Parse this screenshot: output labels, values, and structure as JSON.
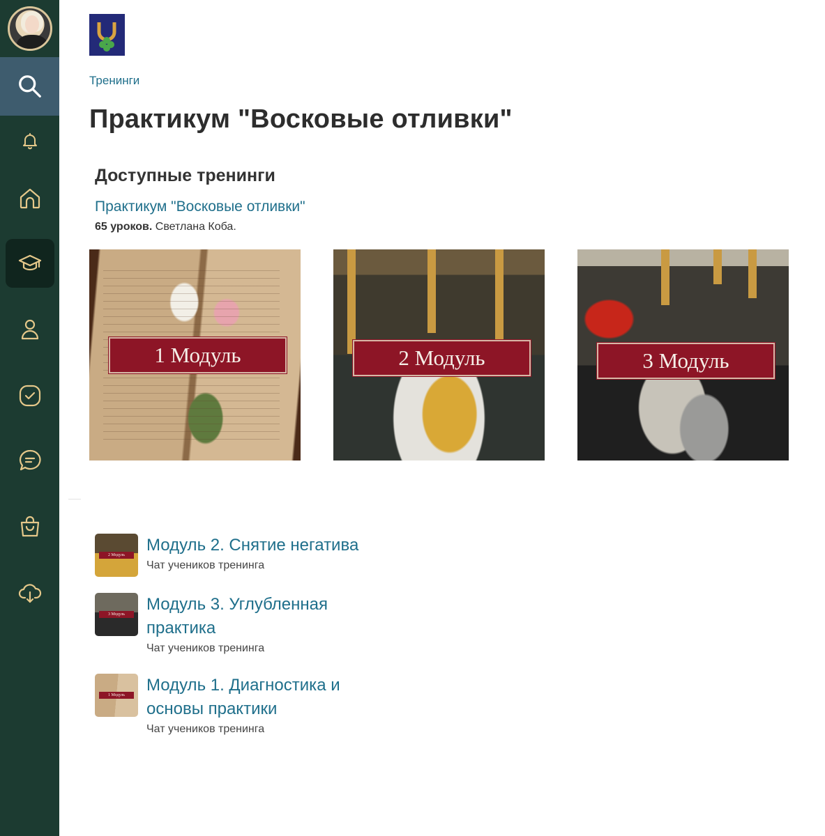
{
  "sidebar": {
    "items": [
      {
        "id": "search",
        "icon": "search-icon"
      },
      {
        "id": "notifications",
        "icon": "bell-icon"
      },
      {
        "id": "home",
        "icon": "home-icon"
      },
      {
        "id": "trainings",
        "icon": "graduation-cap-icon",
        "active": true
      },
      {
        "id": "profile",
        "icon": "user-icon"
      },
      {
        "id": "tasks",
        "icon": "checkbox-icon"
      },
      {
        "id": "chats",
        "icon": "chat-icon"
      },
      {
        "id": "shop",
        "icon": "shopping-bag-icon"
      },
      {
        "id": "downloads",
        "icon": "cloud-download-icon"
      }
    ],
    "colors": {
      "background": "#1c3b31",
      "active_background": "#10251e",
      "search_background": "#3e5c6e",
      "icon": "#e5c88a"
    }
  },
  "breadcrumb": "Тренинги",
  "page_title": "Практикум \"Восковые отливки\"",
  "available": {
    "heading": "Доступные тренинги",
    "training_title": "Практикум \"Восковые отливки\"",
    "lessons_count": "65 уроков.",
    "author": " Светлана Коба."
  },
  "modules": [
    {
      "banner": "1 Модуль"
    },
    {
      "banner": "2 Модуль"
    },
    {
      "banner": "3 Модуль"
    }
  ],
  "chats": [
    {
      "title": "Модуль 2. Снятие негатива",
      "subtitle": "Чат учеников тренинга",
      "thumb_banner": "2 Модуль"
    },
    {
      "title": "Модуль 3. Углубленная практика",
      "subtitle": "Чат учеников тренинга",
      "thumb_banner": "3 Модуль"
    },
    {
      "title": "Модуль 1. Диагностика и основы практики",
      "subtitle": "Чат учеников тренинга",
      "thumb_banner": "1 Модуль"
    }
  ],
  "colors": {
    "link": "#1f6f8b",
    "banner": "#8d1526",
    "logo_background": "#232a78"
  }
}
